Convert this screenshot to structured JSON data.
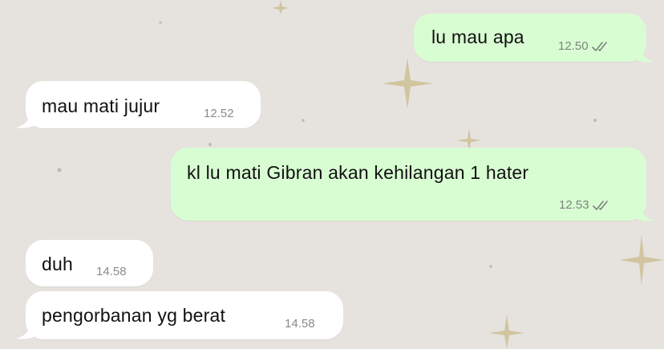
{
  "messages": [
    {
      "direction": "outgoing",
      "text": "lu mau apa",
      "time": "12.50",
      "status_icon": "double-check-icon"
    },
    {
      "direction": "incoming",
      "text": "mau mati jujur",
      "time": "12.52"
    },
    {
      "direction": "outgoing",
      "text": "kl lu mati Gibran akan kehilangan 1 hater",
      "time": "12.53",
      "status_icon": "double-check-icon"
    },
    {
      "direction": "incoming",
      "text": "duh",
      "time": "14.58"
    },
    {
      "direction": "incoming",
      "text": "pengorbanan yg berat",
      "time": "14.58"
    }
  ],
  "colors": {
    "wallpaper": "#e6e3df",
    "outgoing_bubble": "#d9fdd3",
    "incoming_bubble": "#ffffff",
    "sparkle": "#c9b98c"
  }
}
